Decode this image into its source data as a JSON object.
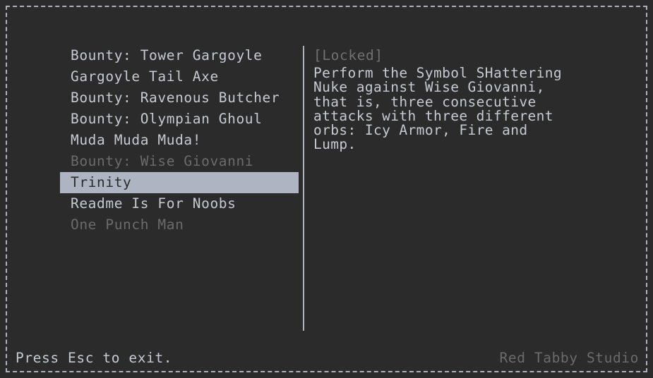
{
  "window": {
    "background_color": "#2b2b2b",
    "border_color": "#aeb2be",
    "text_color": "#c5cad3",
    "dim_text_color": "#6b6b6b",
    "highlight_color": "#aeb4c2"
  },
  "quest_list": {
    "items": [
      {
        "label": "Bounty: Tower Gargoyle",
        "state": "normal"
      },
      {
        "label": "Gargoyle Tail Axe",
        "state": "normal"
      },
      {
        "label": "Bounty: Ravenous Butcher",
        "state": "normal"
      },
      {
        "label": "Bounty: Olympian Ghoul",
        "state": "normal"
      },
      {
        "label": "Muda Muda Muda!",
        "state": "normal"
      },
      {
        "label": "Bounty: Wise Giovanni",
        "state": "dim"
      },
      {
        "label": "Trinity",
        "state": "selected"
      },
      {
        "label": "Readme Is For Noobs",
        "state": "normal"
      },
      {
        "label": "One Punch Man",
        "state": "dim"
      }
    ]
  },
  "detail": {
    "status": "[Locked]",
    "description": "Perform the Symbol SHattering\nNuke against Wise Giovanni,\nthat is, three consecutive\nattacks with three different\norbs: Icy Armor, Fire and\nLump."
  },
  "footer": {
    "hint": "Press Esc to exit.",
    "credit": "Red Tabby Studio"
  }
}
